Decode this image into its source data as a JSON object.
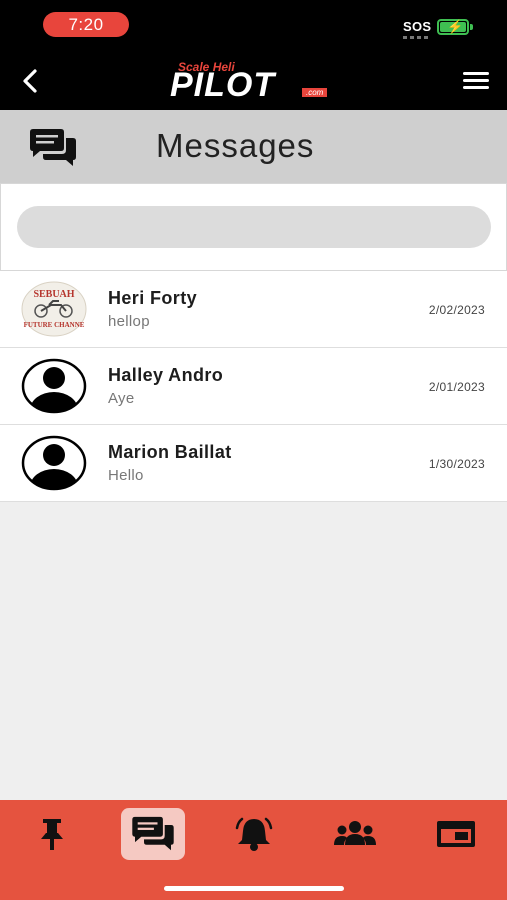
{
  "status_bar": {
    "time": "7:20",
    "carrier": "SOS"
  },
  "header": {
    "logo_small": "Scale Heli",
    "logo_big": "PILOT",
    "logo_suffix": ".com"
  },
  "title_bar": {
    "title": "Messages"
  },
  "search": {
    "placeholder": "",
    "value": ""
  },
  "conversations": [
    {
      "name": "Heri Forty",
      "preview": "hellop",
      "date": "2/02/2023",
      "avatar_text_top": "SEBUAH",
      "avatar_text_bottom": "FUTURE CHANNE"
    },
    {
      "name": "Halley Andro",
      "preview": "Aye",
      "date": "2/01/2023"
    },
    {
      "name": "Marion Baillat",
      "preview": "Hello",
      "date": "1/30/2023"
    }
  ],
  "nav": {
    "items": [
      {
        "icon": "pin-icon",
        "active": false
      },
      {
        "icon": "messages-icon",
        "active": true
      },
      {
        "icon": "bell-icon",
        "active": false
      },
      {
        "icon": "users-icon",
        "active": false
      },
      {
        "icon": "browser-window-icon",
        "active": false
      }
    ]
  },
  "colors": {
    "accent": "#e5533f",
    "status_pill": "#e8453c",
    "battery": "#3fbf52"
  }
}
